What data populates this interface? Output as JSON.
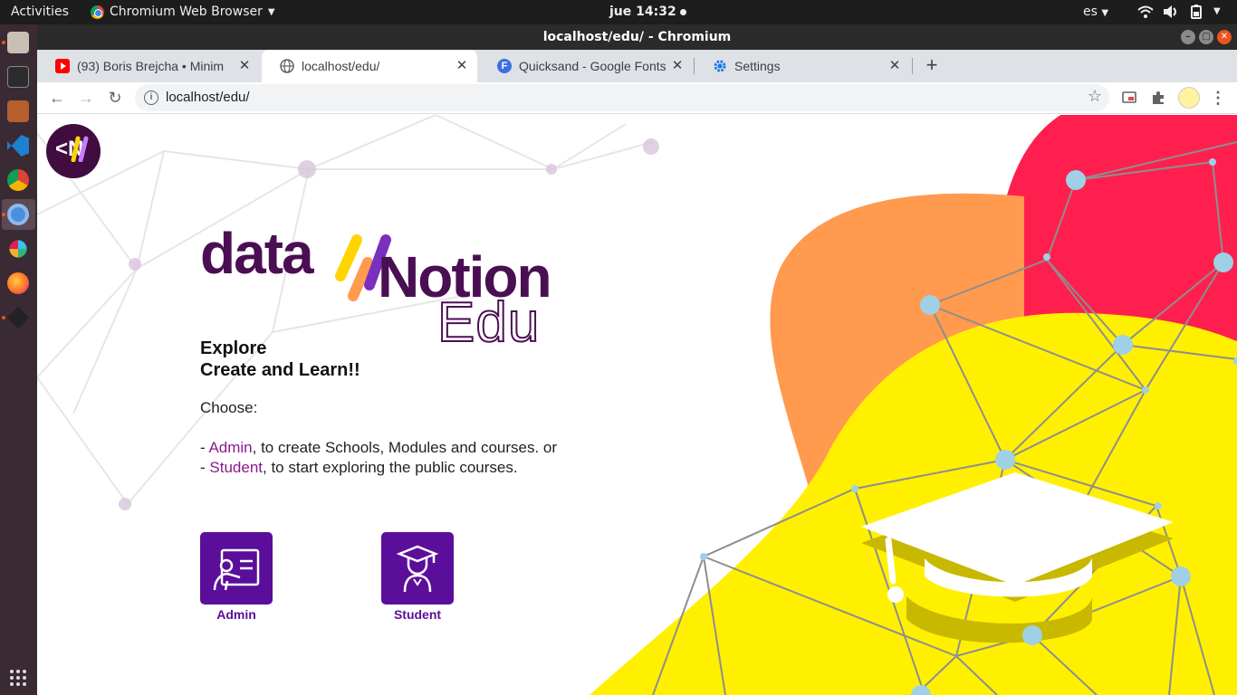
{
  "system": {
    "activities": "Activities",
    "app_name": "Chromium Web Browser",
    "clock": "jue 14:32",
    "language": "es"
  },
  "window": {
    "title": "localhost/edu/ - Chromium"
  },
  "tabs": [
    {
      "label": "(93) Boris Brejcha • Minim",
      "favicon": "youtube-icon",
      "active": false
    },
    {
      "label": "localhost/edu/",
      "favicon": "globe-icon",
      "active": true
    },
    {
      "label": "Quicksand - Google Fonts",
      "favicon": "fonts-f-icon",
      "active": false
    },
    {
      "label": "Settings",
      "favicon": "gear-icon",
      "active": false
    }
  ],
  "toolbar": {
    "url": "localhost/edu/",
    "info_glyph": "i"
  },
  "page": {
    "logo_text": "<N",
    "brand": {
      "part1": "data",
      "part2": "Notion",
      "part3": "Edu"
    },
    "tagline": {
      "line1": "Explore",
      "line2": "Create and Learn!!"
    },
    "choose": "Choose:",
    "admin_line": {
      "prefix": "- ",
      "role": "Admin",
      "rest": ", to create Schools, Modules and courses. or"
    },
    "student_line": {
      "prefix": "- ",
      "role": "Student",
      "rest": ", to start exploring the public courses."
    },
    "cards": {
      "admin_label": "Admin",
      "student_label": "Student"
    }
  },
  "colors": {
    "brand_purple": "#4a0f52",
    "button_purple": "#5b0e9a",
    "highlight": "#8a1a8e",
    "hero_red": "#ff1f4f",
    "hero_orange": "#ff9a4f",
    "hero_yellow": "#fff000",
    "node_blue": "#9fd0e6"
  }
}
